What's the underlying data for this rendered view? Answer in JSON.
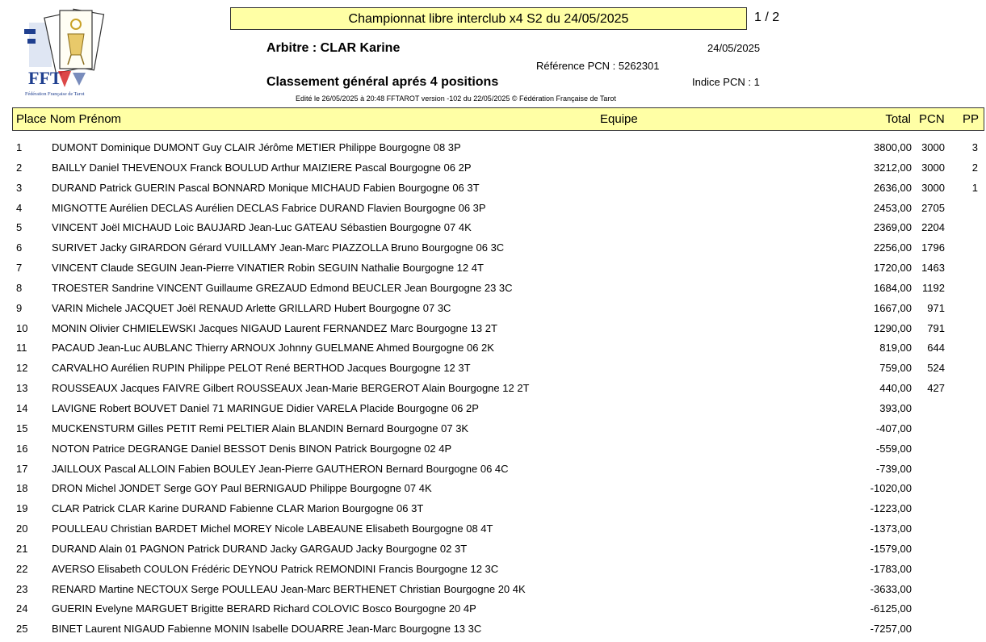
{
  "header": {
    "title": "Championnat libre interclub x4 S2 du 24/05/2025",
    "page": "1 / 2",
    "arbitre": "Arbitre : CLAR Karine",
    "date": "24/05/2025",
    "reference": "Référence PCN : 5262301",
    "classement": "Classement  général aprés 4 positions",
    "indice": "Indice PCN : 1",
    "edit_line": "Edité le 26/05/2025 à 20:48 FFTAROT version -102 du 22/05/2025 © Fédération Française de Tarot"
  },
  "logo": {
    "letters": "FFT",
    "caption": "Fédération Française de Tarot",
    "colors": {
      "blue": "#1f3f8f",
      "red": "#d62828",
      "gold": "#c9a227"
    }
  },
  "columns": {
    "place_nom": "Place Nom Prénom",
    "equipe": "Equipe",
    "total": "Total",
    "pcn": "PCN",
    "pp": "PP"
  },
  "rows": [
    {
      "place": "1",
      "names": "DUMONT Dominique DUMONT Guy CLAIR Jérôme METIER Philippe Bourgogne 08 3P",
      "total": "3800,00",
      "pcn": "3000",
      "pp": "3"
    },
    {
      "place": "2",
      "names": "BAILLY Daniel THEVENOUX Franck BOULUD Arthur MAIZIERE Pascal Bourgogne 06 2P",
      "total": "3212,00",
      "pcn": "3000",
      "pp": "2"
    },
    {
      "place": "3",
      "names": "DURAND Patrick GUERIN Pascal BONNARD Monique MICHAUD Fabien Bourgogne 06 3T",
      "total": "2636,00",
      "pcn": "3000",
      "pp": "1"
    },
    {
      "place": "4",
      "names": "MIGNOTTE Aurélien DECLAS Aurélien DECLAS Fabrice DURAND Flavien Bourgogne 06 3P",
      "total": "2453,00",
      "pcn": "2705",
      "pp": ""
    },
    {
      "place": "5",
      "names": "VINCENT Joël MICHAUD Loic BAUJARD Jean-Luc GATEAU Sébastien Bourgogne 07 4K",
      "total": "2369,00",
      "pcn": "2204",
      "pp": ""
    },
    {
      "place": "6",
      "names": "SURIVET Jacky GIRARDON Gérard VUILLAMY Jean-Marc PIAZZOLLA Bruno Bourgogne 06 3C",
      "total": "2256,00",
      "pcn": "1796",
      "pp": ""
    },
    {
      "place": "7",
      "names": "VINCENT Claude SEGUIN Jean-Pierre VINATIER Robin SEGUIN Nathalie Bourgogne 12 4T",
      "total": "1720,00",
      "pcn": "1463",
      "pp": ""
    },
    {
      "place": "8",
      "names": "TROESTER Sandrine VINCENT Guillaume GREZAUD Edmond BEUCLER Jean Bourgogne 23 3C",
      "total": "1684,00",
      "pcn": "1192",
      "pp": ""
    },
    {
      "place": "9",
      "names": "VARIN Michele JACQUET Joël RENAUD Arlette GRILLARD Hubert Bourgogne 07 3C",
      "total": "1667,00",
      "pcn": "971",
      "pp": ""
    },
    {
      "place": "10",
      "names": "MONIN Olivier CHMIELEWSKI Jacques NIGAUD Laurent FERNANDEZ Marc Bourgogne 13 2T",
      "total": "1290,00",
      "pcn": "791",
      "pp": ""
    },
    {
      "place": "11",
      "names": "PACAUD Jean-Luc AUBLANC Thierry ARNOUX Johnny GUELMANE Ahmed Bourgogne 06 2K",
      "total": "819,00",
      "pcn": "644",
      "pp": ""
    },
    {
      "place": "12",
      "names": "CARVALHO Aurélien RUPIN Philippe PELOT René BERTHOD Jacques Bourgogne 12 3T",
      "total": "759,00",
      "pcn": "524",
      "pp": ""
    },
    {
      "place": "13",
      "names": "ROUSSEAUX Jacques FAIVRE Gilbert ROUSSEAUX Jean-Marie BERGEROT Alain Bourgogne 12 2T",
      "total": "440,00",
      "pcn": "427",
      "pp": ""
    },
    {
      "place": "14",
      "names": "LAVIGNE Robert BOUVET Daniel 71 MARINGUE Didier VARELA Placide Bourgogne 06 2P",
      "total": "393,00",
      "pcn": "",
      "pp": ""
    },
    {
      "place": "15",
      "names": "MUCKENSTURM Gilles PETIT Remi PELTIER Alain BLANDIN Bernard Bourgogne 07 3K",
      "total": "-407,00",
      "pcn": "",
      "pp": ""
    },
    {
      "place": "16",
      "names": "NOTON Patrice DEGRANGE Daniel BESSOT Denis BINON Patrick Bourgogne 02 4P",
      "total": "-559,00",
      "pcn": "",
      "pp": ""
    },
    {
      "place": "17",
      "names": "JAILLOUX Pascal ALLOIN Fabien BOULEY Jean-Pierre GAUTHERON Bernard Bourgogne 06 4C",
      "total": "-739,00",
      "pcn": "",
      "pp": ""
    },
    {
      "place": "18",
      "names": "DRON Michel JONDET Serge GOY Paul BERNIGAUD Philippe Bourgogne 07 4K",
      "total": "-1020,00",
      "pcn": "",
      "pp": ""
    },
    {
      "place": "19",
      "names": "CLAR Patrick CLAR Karine DURAND Fabienne CLAR Marion Bourgogne 06 3T",
      "total": "-1223,00",
      "pcn": "",
      "pp": ""
    },
    {
      "place": "20",
      "names": "POULLEAU Christian BARDET Michel MOREY Nicole LABEAUNE Elisabeth Bourgogne 08 4T",
      "total": "-1373,00",
      "pcn": "",
      "pp": ""
    },
    {
      "place": "21",
      "names": "DURAND Alain 01 PAGNON Patrick DURAND Jacky GARGAUD Jacky Bourgogne 02 3T",
      "total": "-1579,00",
      "pcn": "",
      "pp": ""
    },
    {
      "place": "22",
      "names": "AVERSO Elisabeth COULON Frédéric DEYNOU Patrick REMONDINI Francis Bourgogne 12 3C",
      "total": "-1783,00",
      "pcn": "",
      "pp": ""
    },
    {
      "place": "23",
      "names": "RENARD Martine NECTOUX Serge POULLEAU Jean-Marc BERTHENET Christian Bourgogne 20 4K",
      "total": "-3633,00",
      "pcn": "",
      "pp": ""
    },
    {
      "place": "24",
      "names": "GUERIN Evelyne MARGUET Brigitte BERARD Richard COLOVIC Bosco Bourgogne 20 4P",
      "total": "-6125,00",
      "pcn": "",
      "pp": ""
    },
    {
      "place": "25",
      "names": "BINET Laurent NIGAUD Fabienne MONIN Isabelle DOUARRE Jean-Marc Bourgogne 13 3C",
      "total": "-7257,00",
      "pcn": "",
      "pp": ""
    }
  ]
}
